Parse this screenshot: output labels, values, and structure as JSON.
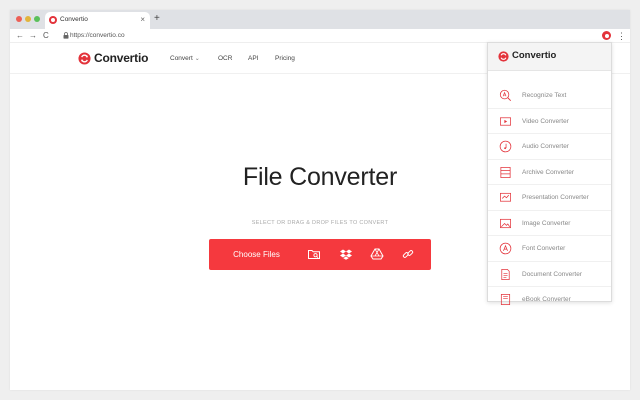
{
  "browser": {
    "tab_title": "Convertio",
    "tab_close": "×",
    "new_tab": "+",
    "url": "https://convertio.co",
    "back": "←",
    "forward": "→",
    "reload": "C",
    "menu": "⋮"
  },
  "site": {
    "brand": "Convertio",
    "nav": [
      {
        "label": "Convert"
      },
      {
        "label": "OCR"
      },
      {
        "label": "API"
      },
      {
        "label": "Pricing"
      }
    ]
  },
  "hero": {
    "title": "File Converter",
    "subtitle": "SELECT OR DRAG & DROP FILES TO CONVERT",
    "choose_files": "Choose Files"
  },
  "panel": {
    "brand": "Convertio",
    "items": [
      {
        "label": "Recognize Text",
        "icon": "magnifier-a-icon"
      },
      {
        "label": "Video Converter",
        "icon": "video-icon"
      },
      {
        "label": "Audio Converter",
        "icon": "audio-icon"
      },
      {
        "label": "Archive Converter",
        "icon": "archive-icon"
      },
      {
        "label": "Presentation Converter",
        "icon": "presentation-icon"
      },
      {
        "label": "Image Converter",
        "icon": "image-icon"
      },
      {
        "label": "Font Converter",
        "icon": "font-icon"
      },
      {
        "label": "Document Converter",
        "icon": "document-icon"
      },
      {
        "label": "eBook Converter",
        "icon": "ebook-icon"
      }
    ]
  },
  "colors": {
    "accent": "#f5393e",
    "brand_red": "#e3333b"
  }
}
